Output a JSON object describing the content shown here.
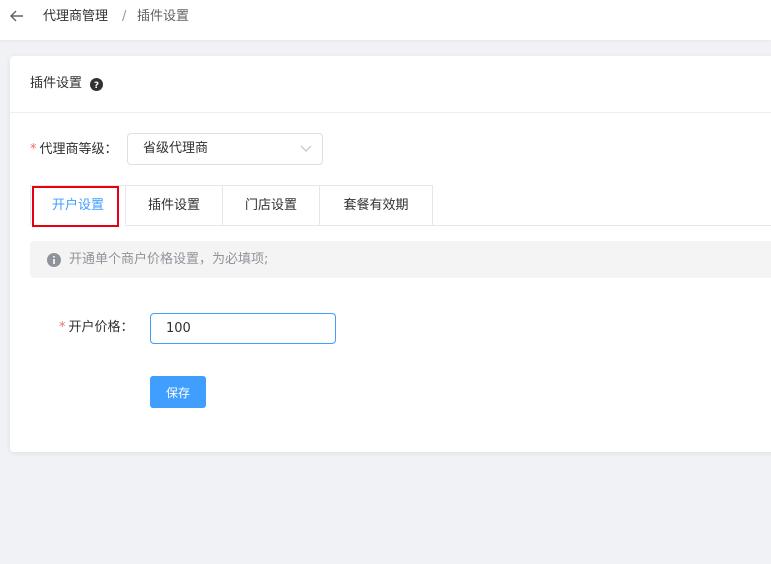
{
  "header": {
    "breadcrumb": [
      "代理商管理",
      "/",
      "插件设置"
    ]
  },
  "card": {
    "title": "插件设置",
    "help_icon": "question-circle-icon"
  },
  "form": {
    "level_label": "代理商等级：",
    "level_required_mark": "*",
    "level_value": "省级代理商",
    "price_label": "开户价格：",
    "price_required_mark": "*",
    "price_value": "100",
    "save_label": "保存"
  },
  "tabs": [
    {
      "label": "开户设置",
      "active": true
    },
    {
      "label": "插件设置",
      "active": false
    },
    {
      "label": "门店设置",
      "active": false
    },
    {
      "label": "套餐有效期",
      "active": false
    }
  ],
  "alert": {
    "icon": "info-circle-icon",
    "message": "开通单个商户价格设置，为必填项;"
  },
  "colors": {
    "primary": "#409eff",
    "required": "#f56c6c",
    "highlight_box": "#e60012"
  }
}
